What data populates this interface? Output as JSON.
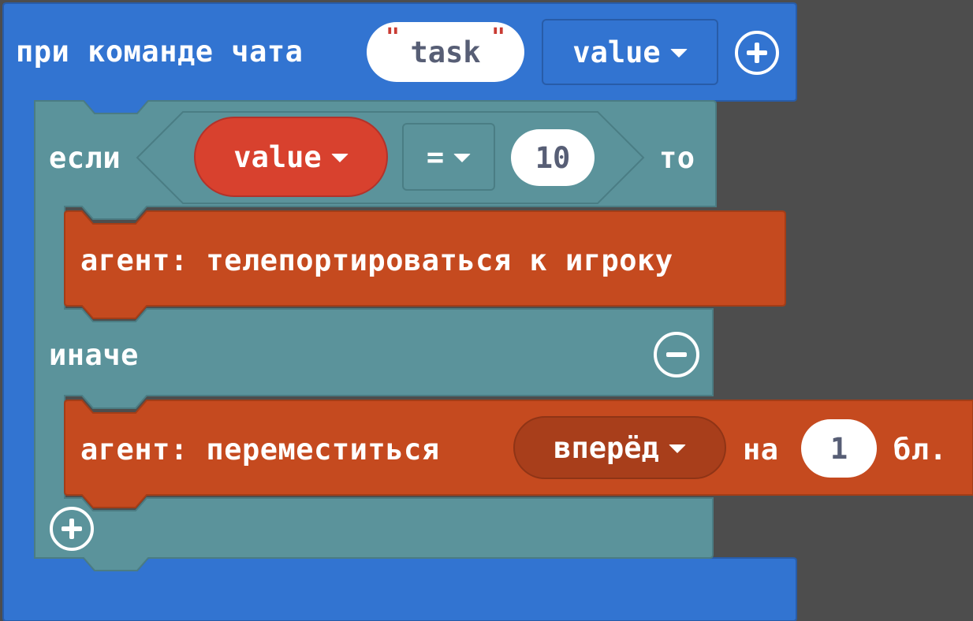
{
  "colors": {
    "canvas": "#4d4d4d",
    "event_block": "#3274d1",
    "logic_block": "#5b939b",
    "agent_block": "#c54a1f",
    "variable_reporter": "#d8412e"
  },
  "event": {
    "label": "при команде чата",
    "command": "task",
    "quote_open": "\"",
    "quote_close": "\"",
    "param_dropdown": "value",
    "add_icon": "plus-circle"
  },
  "if_block": {
    "if_label": "если",
    "condition": {
      "variable": "value",
      "operator": "=",
      "operand": "10"
    },
    "then_label": "то",
    "else_label": "иначе",
    "remove_else_icon": "minus-circle",
    "add_branch_icon": "plus-circle"
  },
  "statements": {
    "teleport": "агент: телепортироваться к игроку",
    "move_label": "агент: переместиться",
    "direction": "вперёд",
    "move_on": "на",
    "distance": "1",
    "unit": "бл."
  }
}
